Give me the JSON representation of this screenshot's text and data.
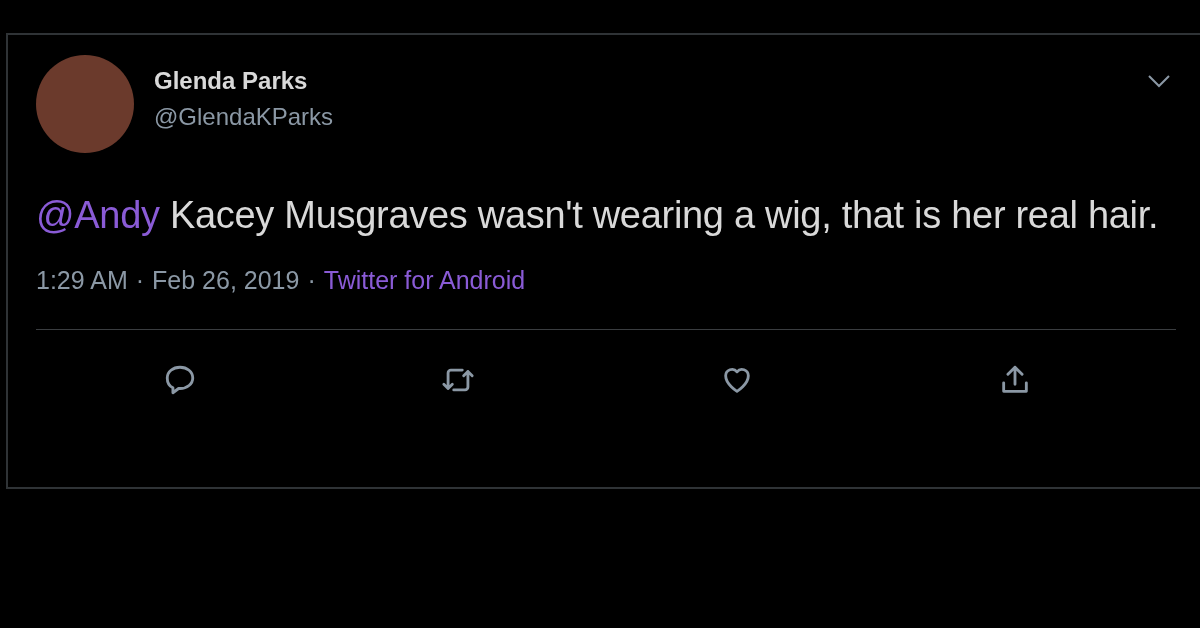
{
  "tweet": {
    "author": {
      "name": "Glenda Parks",
      "handle": "@GlendaKParks"
    },
    "text": [
      {
        "kind": "mention",
        "text": "@Andy"
      },
      {
        "kind": "plain",
        "text": " Kacey Musgraves wasn't wearing a wig, that is her real hair."
      }
    ],
    "meta": [
      {
        "kind": "text",
        "text": "1:29 AM"
      },
      {
        "kind": "separator",
        "text": "·"
      },
      {
        "kind": "text",
        "text": "Feb 26, 2019"
      },
      {
        "kind": "separator",
        "text": "·"
      },
      {
        "kind": "link",
        "text": "Twitter for Android"
      }
    ],
    "actions": [
      {
        "kind": "reply"
      },
      {
        "kind": "retweet"
      },
      {
        "kind": "like"
      },
      {
        "kind": "share"
      }
    ]
  }
}
